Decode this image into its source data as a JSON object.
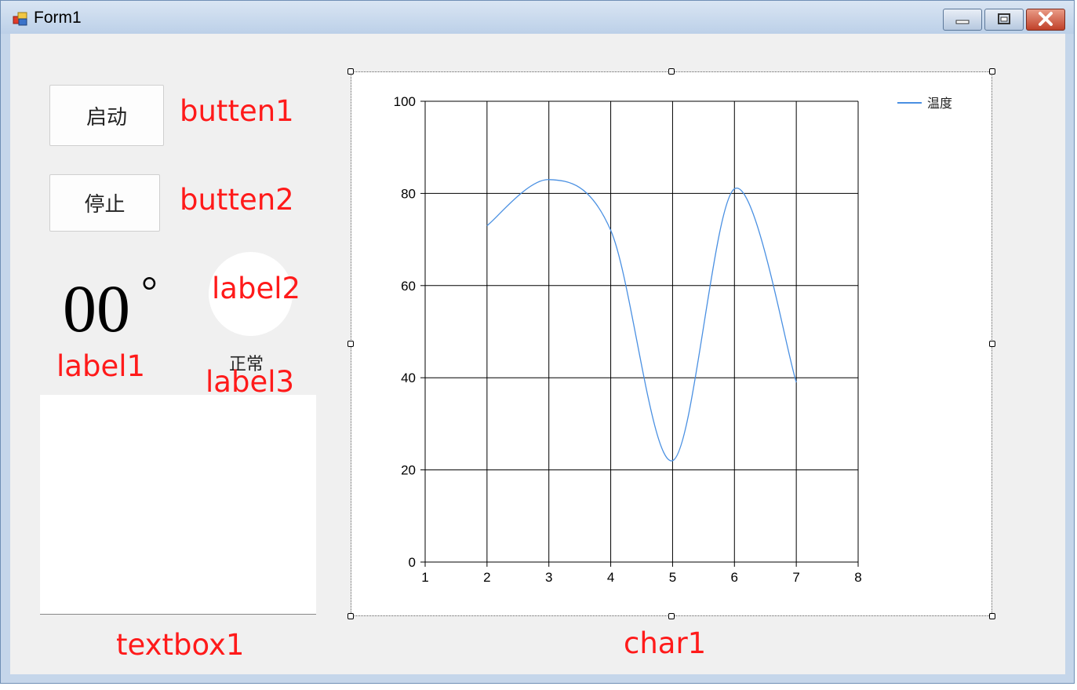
{
  "window": {
    "title": "Form1"
  },
  "controls": {
    "start_button": "启动",
    "stop_button": "停止",
    "temperature": "00",
    "degree_symbol": "°",
    "status": "正常",
    "textbox_value": ""
  },
  "annotations": {
    "button1": "butten1",
    "button2": "butten2",
    "label1": "label1",
    "label2": "label2",
    "label3": "label3",
    "textbox": "textbox1",
    "chart": "char1"
  },
  "colors": {
    "annotation": "#ff1a1a",
    "series": "#4a90e2",
    "indicator": "#ffffff"
  },
  "icons": [
    "app-icon",
    "minimize-icon",
    "maximize-icon",
    "close-icon"
  ],
  "chart_data": {
    "type": "line",
    "title": "",
    "xlabel": "",
    "ylabel": "",
    "xlim": [
      1,
      8
    ],
    "ylim": [
      0,
      100
    ],
    "x_ticks": [
      1,
      2,
      3,
      4,
      5,
      6,
      7,
      8
    ],
    "y_ticks": [
      0,
      20,
      40,
      60,
      80,
      100
    ],
    "grid": true,
    "legend": "top-right",
    "smooth": true,
    "series": [
      {
        "name": "温度",
        "x": [
          2,
          3,
          4,
          5,
          6,
          7
        ],
        "values": [
          73,
          83,
          72,
          22,
          81,
          39
        ]
      }
    ]
  }
}
